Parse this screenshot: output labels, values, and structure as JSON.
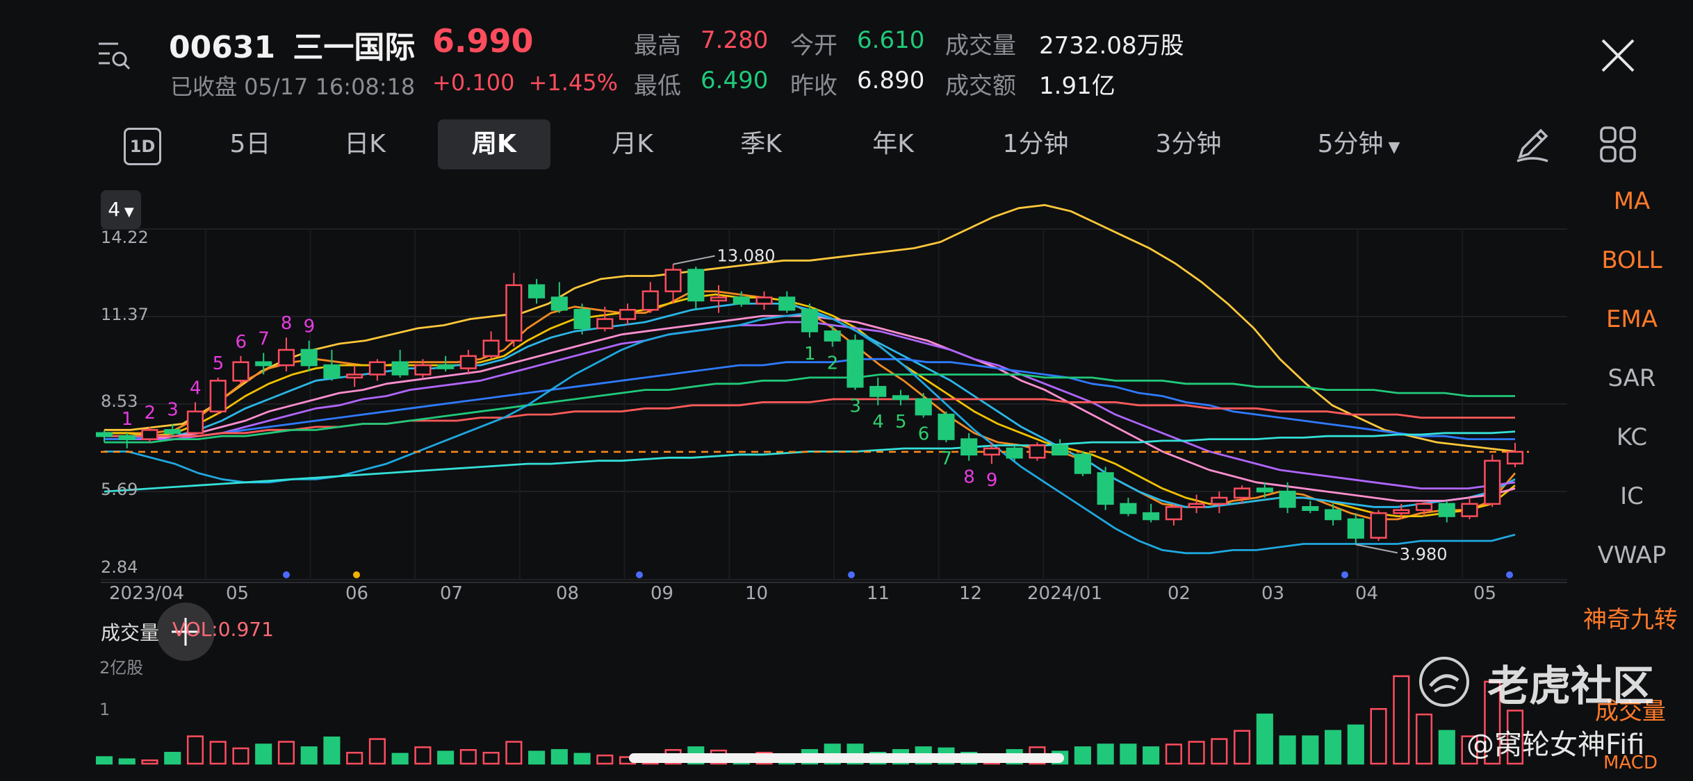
{
  "header": {
    "code": "00631",
    "name": "三一国际",
    "price": "6.990",
    "status": "已收盘 05/17 16:08:18",
    "change": "+0.100",
    "change_pct": "+1.45%",
    "stats": [
      {
        "label": "最高",
        "value": "7.280",
        "tone": "red"
      },
      {
        "label": "今开",
        "value": "6.610",
        "tone": "green"
      },
      {
        "label": "成交量",
        "value": "2732.08万股",
        "tone": "white"
      },
      {
        "label": "最低",
        "value": "6.490",
        "tone": "green"
      },
      {
        "label": "昨收",
        "value": "6.890",
        "tone": "white"
      },
      {
        "label": "成交额",
        "value": "1.91亿",
        "tone": "white"
      }
    ]
  },
  "tabs": [
    "1D",
    "5日",
    "日K",
    "周K",
    "月K",
    "季K",
    "年K",
    "1分钟",
    "3分钟",
    "5分钟"
  ],
  "active_tab": "周K",
  "period_button": "4",
  "indicators": [
    "MA",
    "BOLL",
    "EMA",
    "SAR",
    "KC",
    "IC",
    "VWAP",
    "神奇九转"
  ],
  "volume_panel": {
    "title": "成交量",
    "value": "VOL:0.971",
    "axis_labels": [
      "2亿股",
      "1"
    ],
    "label_right": "成交量",
    "label_cut": "MACD"
  },
  "watermark": {
    "brand": "老虎社区",
    "handle": "@窝轮女神Fifi"
  },
  "colors": {
    "up": "#ff4d5e",
    "down": "#20c97a",
    "bg": "#0e0f11",
    "accent": "#ff7a2a"
  },
  "chart_data": {
    "type": "candlestick",
    "y_ticks": [
      "14.22",
      "11.37",
      "8.53",
      "5.69",
      "2.84"
    ],
    "ylim": [
      2.84,
      14.22
    ],
    "x_labels": [
      "2023/04",
      "05",
      "06",
      "07",
      "08",
      "09",
      "10",
      "11",
      "12",
      "2024/01",
      "02",
      "03",
      "04",
      "05"
    ],
    "annotations": {
      "high": "13.080",
      "low": "3.980"
    },
    "last_close": 6.99,
    "candles": [
      [
        7.6,
        7.7,
        7.3,
        7.5
      ],
      [
        7.5,
        7.6,
        7.1,
        7.4
      ],
      [
        7.4,
        7.8,
        7.3,
        7.7
      ],
      [
        7.7,
        7.9,
        7.5,
        7.6
      ],
      [
        7.6,
        8.6,
        7.5,
        8.3
      ],
      [
        8.3,
        9.4,
        8.2,
        9.3
      ],
      [
        9.3,
        10.1,
        9.2,
        9.9
      ],
      [
        9.9,
        10.2,
        9.5,
        9.8
      ],
      [
        9.8,
        10.7,
        9.6,
        10.3
      ],
      [
        10.3,
        10.6,
        9.6,
        9.8
      ],
      [
        9.8,
        10.3,
        9.3,
        9.4
      ],
      [
        9.4,
        9.8,
        9.1,
        9.5
      ],
      [
        9.5,
        10.0,
        9.3,
        9.9
      ],
      [
        9.9,
        10.3,
        9.4,
        9.5
      ],
      [
        9.5,
        10.0,
        9.4,
        9.8
      ],
      [
        9.8,
        10.1,
        9.6,
        9.7
      ],
      [
        9.7,
        10.3,
        9.5,
        10.1
      ],
      [
        10.1,
        10.9,
        10.0,
        10.6
      ],
      [
        10.6,
        12.8,
        10.4,
        12.4
      ],
      [
        12.4,
        12.6,
        11.8,
        12.0
      ],
      [
        12.0,
        12.5,
        11.5,
        11.6
      ],
      [
        11.6,
        11.8,
        10.8,
        11.0
      ],
      [
        11.0,
        11.7,
        10.9,
        11.3
      ],
      [
        11.3,
        11.8,
        11.1,
        11.6
      ],
      [
        11.6,
        12.5,
        11.5,
        12.2
      ],
      [
        12.2,
        13.08,
        11.8,
        12.9
      ],
      [
        12.9,
        13.0,
        11.6,
        11.9
      ],
      [
        11.9,
        12.4,
        11.5,
        12.0
      ],
      [
        12.0,
        12.2,
        11.7,
        11.8
      ],
      [
        11.8,
        12.2,
        11.6,
        12.0
      ],
      [
        12.0,
        12.2,
        11.5,
        11.6
      ],
      [
        11.6,
        11.8,
        10.7,
        10.9
      ],
      [
        10.9,
        11.1,
        10.4,
        10.6
      ],
      [
        10.6,
        10.8,
        9.0,
        9.1
      ],
      [
        9.1,
        9.4,
        8.5,
        8.8
      ],
      [
        8.8,
        9.0,
        8.5,
        8.7
      ],
      [
        8.7,
        8.9,
        8.1,
        8.2
      ],
      [
        8.2,
        8.3,
        7.3,
        7.4
      ],
      [
        7.4,
        7.6,
        6.7,
        6.9
      ],
      [
        6.9,
        7.3,
        6.6,
        7.1
      ],
      [
        7.1,
        7.2,
        6.7,
        6.8
      ],
      [
        6.8,
        7.3,
        6.7,
        7.2
      ],
      [
        7.2,
        7.4,
        6.9,
        6.9
      ],
      [
        6.9,
        7.0,
        6.2,
        6.3
      ],
      [
        6.3,
        6.5,
        5.1,
        5.3
      ],
      [
        5.3,
        5.5,
        4.9,
        5.0
      ],
      [
        5.0,
        5.3,
        4.7,
        4.8
      ],
      [
        4.8,
        5.3,
        4.6,
        5.2
      ],
      [
        5.2,
        5.6,
        5.0,
        5.3
      ],
      [
        5.3,
        5.7,
        5.0,
        5.5
      ],
      [
        5.5,
        5.9,
        5.3,
        5.8
      ],
      [
        5.8,
        6.0,
        5.5,
        5.7
      ],
      [
        5.7,
        6.0,
        5.0,
        5.2
      ],
      [
        5.2,
        5.4,
        5.0,
        5.1
      ],
      [
        5.1,
        5.3,
        4.6,
        4.8
      ],
      [
        4.8,
        5.0,
        3.98,
        4.2
      ],
      [
        4.2,
        5.1,
        4.1,
        5.0
      ],
      [
        5.0,
        5.3,
        4.8,
        5.1
      ],
      [
        5.1,
        5.4,
        4.9,
        5.3
      ],
      [
        5.3,
        5.4,
        4.7,
        4.9
      ],
      [
        4.9,
        5.5,
        4.8,
        5.3
      ],
      [
        5.3,
        6.9,
        5.2,
        6.7
      ],
      [
        6.61,
        7.28,
        6.49,
        6.99
      ]
    ],
    "volumes": [
      0.12,
      0.08,
      0.06,
      0.2,
      0.5,
      0.4,
      0.28,
      0.35,
      0.4,
      0.3,
      0.48,
      0.2,
      0.45,
      0.18,
      0.3,
      0.22,
      0.25,
      0.2,
      0.4,
      0.22,
      0.25,
      0.18,
      0.15,
      0.12,
      0.16,
      0.25,
      0.3,
      0.24,
      0.15,
      0.2,
      0.12,
      0.25,
      0.35,
      0.35,
      0.2,
      0.25,
      0.3,
      0.28,
      0.2,
      0.12,
      0.25,
      0.3,
      0.22,
      0.3,
      0.35,
      0.35,
      0.3,
      0.35,
      0.4,
      0.45,
      0.6,
      0.9,
      0.5,
      0.5,
      0.6,
      0.7,
      1.0,
      1.6,
      0.9,
      0.6,
      0.5,
      1.5,
      0.971
    ],
    "seq_up": [
      [
        1,
        "1"
      ],
      [
        2,
        "2"
      ],
      [
        3,
        "3"
      ],
      [
        4,
        "4"
      ],
      [
        5,
        "5"
      ],
      [
        6,
        "6"
      ],
      [
        7,
        "7"
      ],
      [
        8,
        "8"
      ],
      [
        9,
        "9"
      ]
    ],
    "seq_down": [
      [
        31,
        "1"
      ],
      [
        32,
        "2"
      ],
      [
        33,
        "3"
      ],
      [
        34,
        "4"
      ],
      [
        35,
        "5"
      ],
      [
        36,
        "6"
      ],
      [
        37,
        "7"
      ],
      [
        38,
        "8"
      ],
      [
        39,
        "9"
      ]
    ],
    "lines": [
      {
        "color": "#ffc83a",
        "pts": [
          7.7,
          7.7,
          7.8,
          7.9,
          8.4,
          9.0,
          9.6,
          10.0,
          10.3,
          10.5,
          10.6,
          10.8,
          11.0,
          11.1,
          11.3,
          11.4,
          11.5,
          11.8,
          12.3,
          12.6,
          12.7,
          12.7,
          12.8,
          12.9,
          13.0,
          13.1,
          13.2,
          13.2,
          13.3,
          13.4,
          13.5,
          13.6,
          13.8,
          14.2,
          14.6,
          14.9,
          15.0,
          14.8,
          14.4,
          14.0,
          13.6,
          13.1,
          12.5,
          11.8,
          11.0,
          10.0,
          9.2,
          8.5,
          8.1,
          7.7,
          7.5,
          7.3,
          7.2,
          7.1,
          7.0
        ]
      },
      {
        "color": "#f28b22",
        "pts": [
          7.6,
          7.6,
          7.6,
          7.7,
          8.1,
          8.7,
          9.3,
          9.7,
          9.9,
          10.0,
          9.9,
          9.8,
          9.8,
          9.9,
          9.9,
          9.9,
          10.0,
          10.3,
          11.0,
          11.5,
          11.7,
          11.6,
          11.5,
          11.5,
          11.8,
          12.2,
          12.2,
          12.1,
          12.0,
          11.9,
          11.5,
          11.0,
          10.4,
          9.8,
          9.3,
          8.7,
          8.1,
          7.6,
          7.3,
          7.2,
          7.0,
          6.9,
          6.6,
          6.1,
          5.7,
          5.3,
          5.2,
          5.2,
          5.4,
          5.5,
          5.7,
          5.6,
          5.3,
          5.0,
          4.8,
          4.8,
          5.0,
          5.1,
          5.1,
          5.4,
          6.3
        ]
      },
      {
        "color": "#f2c200",
        "pts": [
          7.6,
          7.6,
          7.5,
          7.6,
          7.9,
          8.3,
          8.8,
          9.2,
          9.5,
          9.7,
          9.8,
          9.8,
          9.8,
          9.8,
          9.8,
          9.8,
          9.9,
          10.1,
          10.6,
          11.0,
          11.3,
          11.4,
          11.5,
          11.6,
          11.8,
          12.0,
          12.1,
          12.0,
          12.0,
          11.9,
          11.7,
          11.4,
          11.0,
          10.4,
          9.8,
          9.3,
          8.8,
          8.3,
          7.9,
          7.6,
          7.3,
          7.1,
          6.9,
          6.6,
          6.2,
          5.8,
          5.5,
          5.3,
          5.3,
          5.4,
          5.5,
          5.5,
          5.4,
          5.2,
          5.0,
          4.9,
          4.9,
          5.0,
          5.1,
          5.3,
          5.9
        ]
      },
      {
        "color": "#2ab7e8",
        "pts": [
          7.5,
          7.5,
          7.5,
          7.5,
          7.7,
          8.0,
          8.4,
          8.7,
          9.0,
          9.3,
          9.4,
          9.5,
          9.6,
          9.7,
          9.7,
          9.8,
          9.8,
          10.0,
          10.4,
          10.7,
          10.9,
          11.0,
          11.1,
          11.2,
          11.4,
          11.6,
          11.7,
          11.8,
          11.8,
          11.8,
          11.6,
          11.3,
          10.9,
          10.5,
          10.1,
          9.7,
          9.3,
          8.8,
          8.3,
          7.8,
          7.4,
          7.0,
          6.6,
          6.1,
          5.7,
          5.4,
          5.2,
          5.2,
          5.3,
          5.4,
          5.5,
          5.5,
          5.4,
          5.3,
          5.2,
          5.2,
          5.3,
          5.4,
          5.5,
          5.7,
          6.1
        ]
      },
      {
        "color": "#ff8fd0",
        "pts": [
          7.4,
          7.4,
          7.4,
          7.5,
          7.6,
          7.8,
          8.0,
          8.3,
          8.5,
          8.7,
          8.9,
          9.0,
          9.2,
          9.3,
          9.4,
          9.5,
          9.6,
          9.8,
          10.0,
          10.2,
          10.4,
          10.6,
          10.8,
          10.9,
          11.0,
          11.1,
          11.2,
          11.3,
          11.4,
          11.4,
          11.4,
          11.3,
          11.2,
          11.0,
          10.8,
          10.6,
          10.3,
          10.0,
          9.7,
          9.3,
          9.0,
          8.6,
          8.2,
          7.8,
          7.4,
          7.0,
          6.7,
          6.4,
          6.2,
          6.0,
          5.9,
          5.8,
          5.7,
          5.6,
          5.5,
          5.4,
          5.4,
          5.4,
          5.5,
          5.6,
          5.8
        ]
      },
      {
        "color": "#b066ff",
        "pts": [
          7.4,
          7.4,
          7.4,
          7.4,
          7.5,
          7.6,
          7.8,
          8.0,
          8.2,
          8.4,
          8.5,
          8.7,
          8.8,
          9.0,
          9.1,
          9.2,
          9.3,
          9.5,
          9.7,
          9.9,
          10.1,
          10.3,
          10.5,
          10.6,
          10.8,
          10.9,
          11.0,
          11.1,
          11.1,
          11.2,
          11.2,
          11.1,
          11.0,
          10.9,
          10.7,
          10.5,
          10.3,
          10.0,
          9.8,
          9.5,
          9.2,
          8.9,
          8.6,
          8.2,
          7.9,
          7.6,
          7.3,
          7.0,
          6.8,
          6.6,
          6.4,
          6.3,
          6.2,
          6.1,
          6.0,
          5.9,
          5.8,
          5.8,
          5.8,
          5.9,
          6.0
        ]
      },
      {
        "color": "#2f7bff",
        "pts": [
          7.4,
          7.4,
          7.5,
          7.5,
          7.5,
          7.6,
          7.7,
          7.8,
          7.9,
          8.0,
          8.1,
          8.2,
          8.3,
          8.4,
          8.5,
          8.6,
          8.7,
          8.8,
          8.9,
          9.0,
          9.1,
          9.2,
          9.3,
          9.4,
          9.5,
          9.6,
          9.7,
          9.8,
          9.8,
          9.9,
          9.9,
          9.9,
          10.0,
          10.0,
          10.0,
          9.9,
          9.9,
          9.8,
          9.7,
          9.6,
          9.5,
          9.4,
          9.2,
          9.1,
          8.9,
          8.8,
          8.6,
          8.5,
          8.3,
          8.2,
          8.1,
          8.0,
          7.9,
          7.8,
          7.7,
          7.6,
          7.5,
          7.5,
          7.4,
          7.4,
          7.4
        ]
      },
      {
        "color": "#ff5a5a",
        "pts": [
          7.5,
          7.5,
          7.5,
          7.5,
          7.5,
          7.6,
          7.6,
          7.7,
          7.7,
          7.8,
          7.8,
          7.9,
          7.9,
          8.0,
          8.0,
          8.0,
          8.1,
          8.1,
          8.2,
          8.2,
          8.3,
          8.3,
          8.3,
          8.4,
          8.4,
          8.5,
          8.5,
          8.5,
          8.6,
          8.6,
          8.6,
          8.7,
          8.7,
          8.7,
          8.7,
          8.7,
          8.7,
          8.7,
          8.7,
          8.7,
          8.7,
          8.6,
          8.6,
          8.6,
          8.5,
          8.5,
          8.5,
          8.4,
          8.4,
          8.4,
          8.3,
          8.3,
          8.3,
          8.2,
          8.2,
          8.2,
          8.1,
          8.1,
          8.1,
          8.1,
          8.1
        ]
      },
      {
        "color": "#20c97a",
        "pts": [
          7.3,
          7.3,
          7.3,
          7.4,
          7.4,
          7.5,
          7.5,
          7.6,
          7.7,
          7.7,
          7.8,
          7.9,
          7.9,
          8.0,
          8.1,
          8.2,
          8.3,
          8.4,
          8.5,
          8.6,
          8.7,
          8.8,
          8.9,
          9.0,
          9.0,
          9.1,
          9.2,
          9.2,
          9.3,
          9.3,
          9.4,
          9.4,
          9.4,
          9.5,
          9.5,
          9.5,
          9.5,
          9.5,
          9.5,
          9.5,
          9.4,
          9.4,
          9.4,
          9.3,
          9.3,
          9.3,
          9.2,
          9.2,
          9.2,
          9.1,
          9.1,
          9.1,
          9.0,
          9.0,
          9.0,
          8.9,
          8.9,
          8.9,
          8.8,
          8.8,
          8.8
        ]
      },
      {
        "color": "#1fa8e0",
        "pts": [
          7.0,
          7.0,
          6.8,
          6.6,
          6.3,
          6.1,
          6.0,
          6.0,
          6.1,
          6.1,
          6.2,
          6.4,
          6.6,
          6.9,
          7.2,
          7.5,
          7.8,
          8.1,
          8.5,
          9.0,
          9.5,
          9.9,
          10.3,
          10.6,
          10.8,
          10.9,
          11.0,
          11.1,
          11.3,
          11.4,
          11.5,
          11.3,
          10.9,
          10.4,
          9.8,
          9.1,
          8.4,
          7.7,
          7.1,
          6.5,
          6.0,
          5.5,
          5.0,
          4.5,
          4.1,
          3.8,
          3.7,
          3.7,
          3.8,
          3.8,
          3.9,
          4.0,
          4.0,
          4.0,
          4.0,
          4.0,
          4.1,
          4.1,
          4.1,
          4.1,
          4.3
        ]
      },
      {
        "color": "#34e0d8",
        "pts": [
          5.7,
          5.75,
          5.8,
          5.85,
          5.9,
          5.95,
          6.0,
          6.05,
          6.1,
          6.15,
          6.2,
          6.25,
          6.3,
          6.35,
          6.4,
          6.45,
          6.5,
          6.55,
          6.6,
          6.6,
          6.65,
          6.7,
          6.7,
          6.75,
          6.8,
          6.8,
          6.85,
          6.9,
          6.9,
          6.95,
          7.0,
          7.0,
          7.0,
          7.05,
          7.1,
          7.1,
          7.1,
          7.15,
          7.2,
          7.2,
          7.2,
          7.25,
          7.3,
          7.3,
          7.3,
          7.35,
          7.35,
          7.4,
          7.4,
          7.4,
          7.45,
          7.45,
          7.5,
          7.5,
          7.5,
          7.55,
          7.55,
          7.6,
          7.6,
          7.6,
          7.65
        ]
      }
    ]
  }
}
